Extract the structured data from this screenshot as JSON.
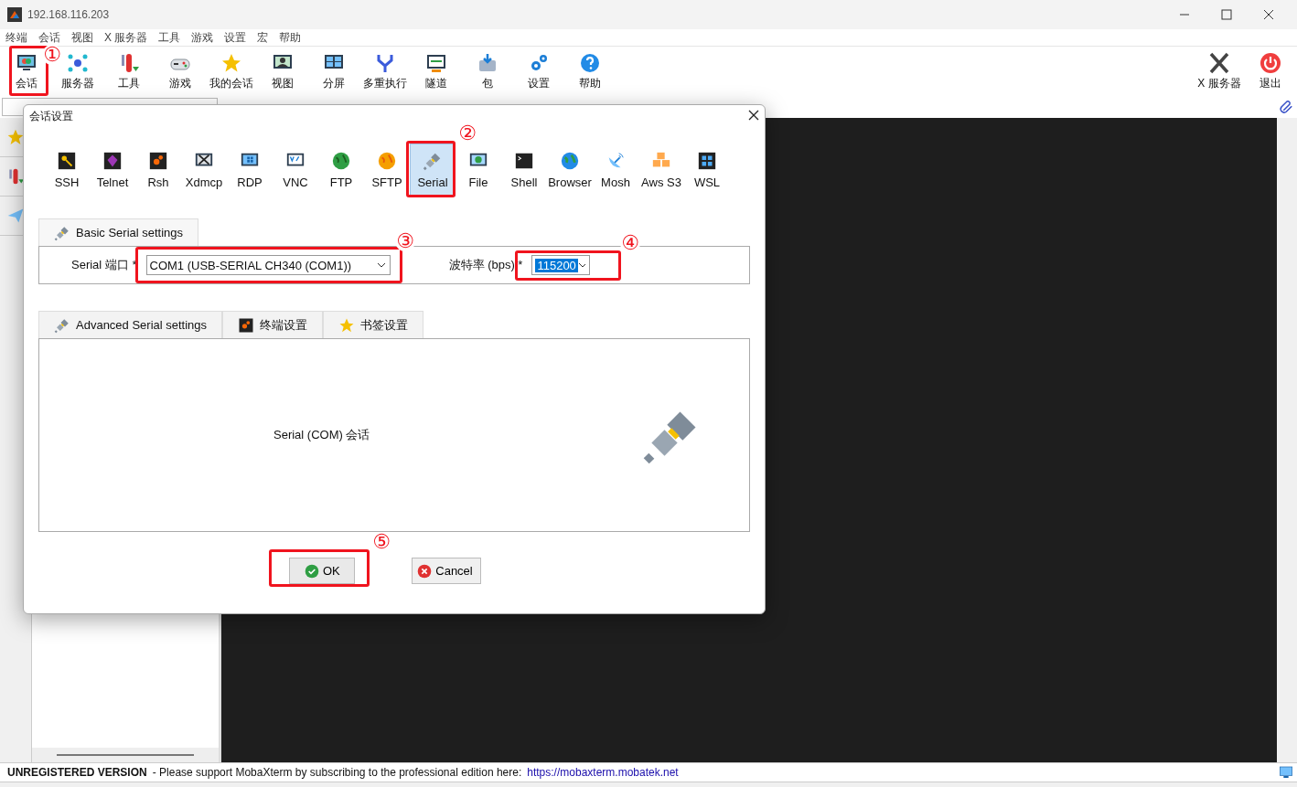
{
  "window": {
    "title": "192.168.116.203"
  },
  "menu": [
    "终端",
    "会话",
    "视图",
    "X 服务器",
    "工具",
    "游戏",
    "设置",
    "宏",
    "帮助"
  ],
  "toolbar": [
    {
      "label": "会话"
    },
    {
      "label": "服务器"
    },
    {
      "label": "工具"
    },
    {
      "label": "游戏"
    },
    {
      "label": "我的会话"
    },
    {
      "label": "视图"
    },
    {
      "label": "分屏"
    },
    {
      "label": "多重执行"
    },
    {
      "label": "隧道"
    },
    {
      "label": "包"
    },
    {
      "label": "设置"
    },
    {
      "label": "帮助"
    }
  ],
  "toolbar_right": [
    {
      "label": "X 服务器"
    },
    {
      "label": "退出"
    }
  ],
  "dialog": {
    "title": "会话设置",
    "session_types": [
      {
        "label": "SSH",
        "selected": false
      },
      {
        "label": "Telnet",
        "selected": false
      },
      {
        "label": "Rsh",
        "selected": false
      },
      {
        "label": "Xdmcp",
        "selected": false
      },
      {
        "label": "RDP",
        "selected": false
      },
      {
        "label": "VNC",
        "selected": false
      },
      {
        "label": "FTP",
        "selected": false
      },
      {
        "label": "SFTP",
        "selected": false
      },
      {
        "label": "Serial",
        "selected": true
      },
      {
        "label": "File",
        "selected": false
      },
      {
        "label": "Shell",
        "selected": false
      },
      {
        "label": "Browser",
        "selected": false
      },
      {
        "label": "Mosh",
        "selected": false
      },
      {
        "label": "Aws S3",
        "selected": false
      },
      {
        "label": "WSL",
        "selected": false
      }
    ],
    "basic_tab": "Basic Serial settings",
    "serial_port": {
      "label": "Serial 端口 *",
      "value": "COM1  (USB-SERIAL CH340 (COM1))"
    },
    "baud_rate": {
      "label": "波特率 (bps) *",
      "value": "115200"
    },
    "tabs": [
      "Advanced Serial settings",
      "终端设置",
      "书签设置"
    ],
    "description": "Serial (COM) 会话",
    "buttons": [
      {
        "label": "OK",
        "kind": "ok"
      },
      {
        "label": "Cancel",
        "kind": "cancel"
      }
    ]
  },
  "annotations": [
    "①",
    "②",
    "③",
    "④",
    "⑤"
  ],
  "status_bar": {
    "title": "UNREGISTERED VERSION",
    "message": "-  Please support MobaXterm by subscribing to the professional edition here:",
    "link": "https://mobaxterm.mobatek.net"
  }
}
